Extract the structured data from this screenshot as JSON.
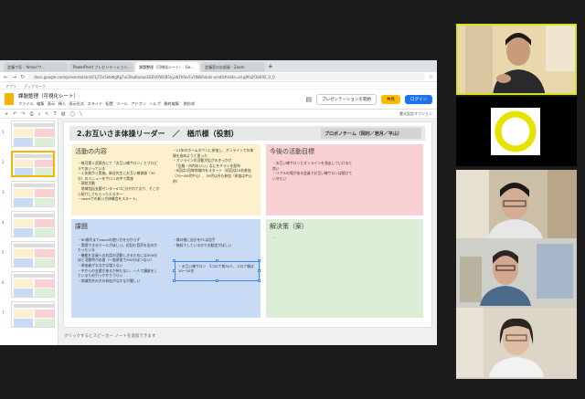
{
  "browser": {
    "tabs": [
      "会議で気 - Yahoo!ワ...",
      "PowerPoint プレゼンテーション...",
      "課題整理（可視化シート）- Go...",
      "会議室のお部屋 - Zoom"
    ],
    "url": "docs.google.com/presentation/d/1j7Zv5kbdlgRg7uCBsaKuoua1EEVOW2B5vyzb7hfovFuYWbRxkds-x/edit#slide=id.g9fa2f1b692_0_0",
    "bookmarks": "アプリ　　ブックマーク"
  },
  "doc": {
    "title": "課題整理（可視化シート）",
    "menu": [
      "ファイル",
      "編集",
      "表示",
      "挿入",
      "表示形式",
      "スライド",
      "配置",
      "ツール",
      "アドオン",
      "ヘルプ",
      "最終編集: 数秒前"
    ],
    "present_label": "プレゼンテーションを開始",
    "share_label": "共有",
    "login_label": "ログイン",
    "toolbar_right": "書式設定オプション",
    "slide_numbers": [
      "1",
      "2",
      "3",
      "4",
      "5",
      "6",
      "7"
    ],
    "notes_placeholder": "クリックするとスピーカー ノートを追加できます"
  },
  "slide": {
    "title": "2.お互いさま体操リーダー　／　楢爪様（役割）",
    "team": "プロボノチーム（岡村／若月／平山）",
    "activity": {
      "title": "活動の内容",
      "items": [
        "・毎月第１武蔵台にて「お互い様サロン」とプロビラであいっている",
        "・１年前から実施。新谷先生にお互い様体操（30分）のメニューをサロンの中で実施",
        "・現状活動",
        "　地域包括支援センター4つに分かれており、そこから紹介してもらったエスター",
        "・zoomでの新い方体験会をスタート。"
      ],
      "items2": [
        "・21年のホームタウンに参加し、オンラインでの体操を始めようと思った",
        "・オンラインの活動が広がるきっかけ",
        "　「広報・市内のいい」なにをチラシを配布",
        "・6回は1回毎地域内をスタート（初回は10名参加（70～80代中心）、30代以外も参加（参加は中心的）"
      ]
    },
    "goals": {
      "title": "今後の活動目標",
      "items": [
        "・お互い様サロンとオンラインを並走していけると良い",
        "・リアルの場がある会員でお互い様サロンは続けていきたい"
      ]
    },
    "issues": {
      "title": "課題",
      "items": [
        "・80歳代までzoomの使い方を分からず",
        "・実際できるマールがほしい。初回も音声を出のかたったいる",
        "・機能を全員へのお話の活動しきるためには500分ほど活動時が必要（一般参加で900分ほつない）",
        "・参加者がななかな増えない",
        "・中からの支援が来るか待たない…一人で講座をしているため引っかかりづらい",
        "・地域別共の方の参加がなかなか難しい"
      ],
      "items2": [
        "・様の後に自分をPCは苦手",
        "・無料でしているのでお勧定がほしい"
      ]
    },
    "solution": {
      "title": "解決策（案）",
      "items": [
        "・"
      ]
    },
    "selected_text": "・お互い様サロン　【コロナ前30人、コロナ後は10～20名"
  }
}
